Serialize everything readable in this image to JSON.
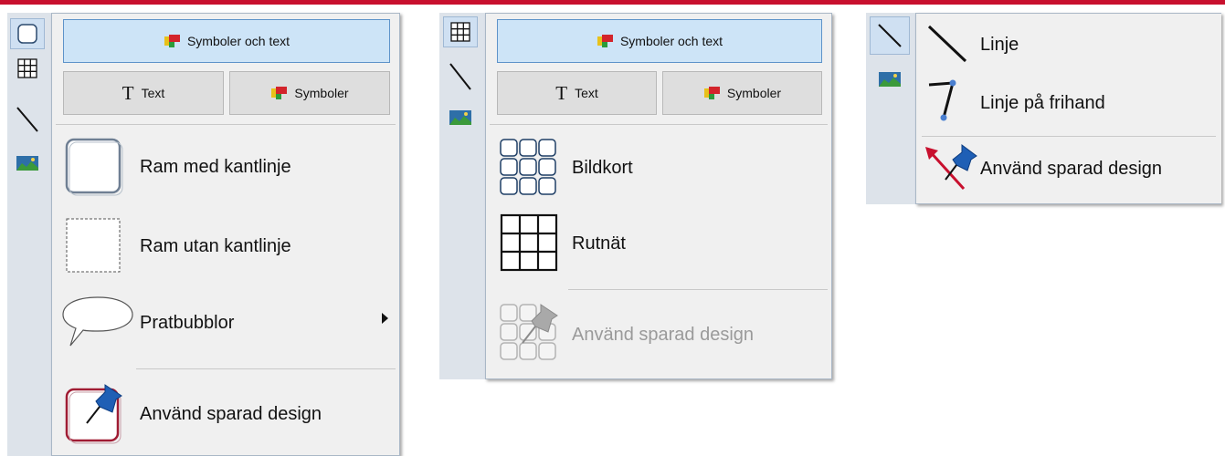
{
  "panel1": {
    "top_button": "Symboler och text",
    "text_button": "Text",
    "symbols_button": "Symboler",
    "items": [
      {
        "label": "Ram med kantlinje"
      },
      {
        "label": "Ram utan kantlinje"
      },
      {
        "label": "Pratbubblor"
      },
      {
        "label": "Använd sparad design"
      }
    ]
  },
  "panel2": {
    "top_button": "Symboler och text",
    "text_button": "Text",
    "symbols_button": "Symboler",
    "items": [
      {
        "label": "Bildkort"
      },
      {
        "label": "Rutnät"
      },
      {
        "label": "Använd sparad design",
        "disabled": true
      }
    ]
  },
  "panel3": {
    "items": [
      {
        "label": "Linje"
      },
      {
        "label": "Linje på frihand"
      },
      {
        "label": "Använd sparad design"
      }
    ]
  },
  "colors": {
    "accent_bar": "#c8102e",
    "selected_button_bg": "#cde4f7",
    "selected_button_border": "#5e93c9",
    "menu_bg": "#f0f0f0",
    "strip_bg": "#dde3ea"
  }
}
